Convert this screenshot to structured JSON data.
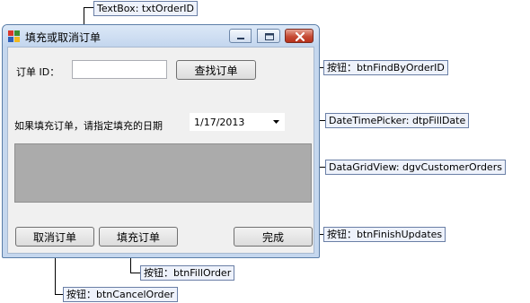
{
  "window": {
    "title": "填充或取消订单",
    "min_icon": "minimize-icon",
    "max_icon": "maximize-icon",
    "close_icon": "close-icon",
    "colors": {
      "close_button": "#c64b35",
      "frame": "#c5d7ee",
      "client": "#f0f0f0"
    }
  },
  "form": {
    "order_id_label": "订单 ID：",
    "order_id_value": "",
    "find_button": "查找订单",
    "fill_date_label": "如果填充订单，请指定填充的日期",
    "fill_date_value": "1/17/2013",
    "cancel_button": "取消订单",
    "fill_button": "填充订单",
    "finish_button": "完成"
  },
  "callouts": {
    "txtOrderID": "TextBox: txtOrderID",
    "btnFindByOrderID": "按钮：btnFindByOrderID",
    "dtpFillDate": "DateTimePicker: dtpFillDate",
    "dgvCustomerOrders": "DataGridView: dgvCustomerOrders",
    "btnFinishUpdates": "按钮：btnFinishUpdates",
    "btnFillOrder": "按钮：btnFillOrder",
    "btnCancelOrder": "按钮：btnCancelOrder"
  }
}
